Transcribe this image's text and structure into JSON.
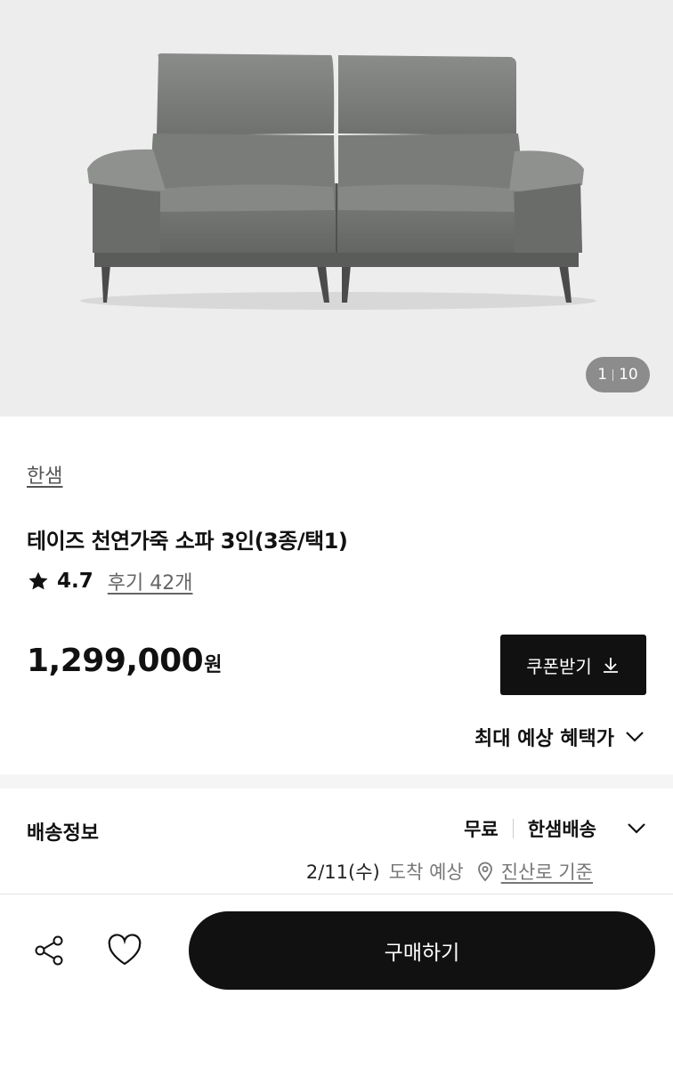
{
  "gallery": {
    "current": "1",
    "total": "10",
    "image_alt": "grey leather sofa"
  },
  "product": {
    "brand": "한샘",
    "title": "테이즈 천연가죽 소파 3인(3종/택1)",
    "rating": "4.7",
    "review_link": "후기 42개",
    "price": "1,299,000",
    "currency": "원",
    "coupon_button": "쿠폰받기",
    "benefit_toggle": "최대 예상 혜택가"
  },
  "shipping": {
    "label": "배송정보",
    "fee": "무료",
    "carrier": "한샘배송",
    "arrival_date": "2/11(수)",
    "arrival_text": "도착 예상",
    "location": "진산로 기준"
  },
  "bottom_bar": {
    "buy_button": "구매하기"
  },
  "icons": {
    "star": "star-icon",
    "download": "download-arrow-icon",
    "chevron": "chevron-down-icon",
    "location": "location-pin-icon",
    "share": "share-icon",
    "heart": "heart-icon"
  }
}
